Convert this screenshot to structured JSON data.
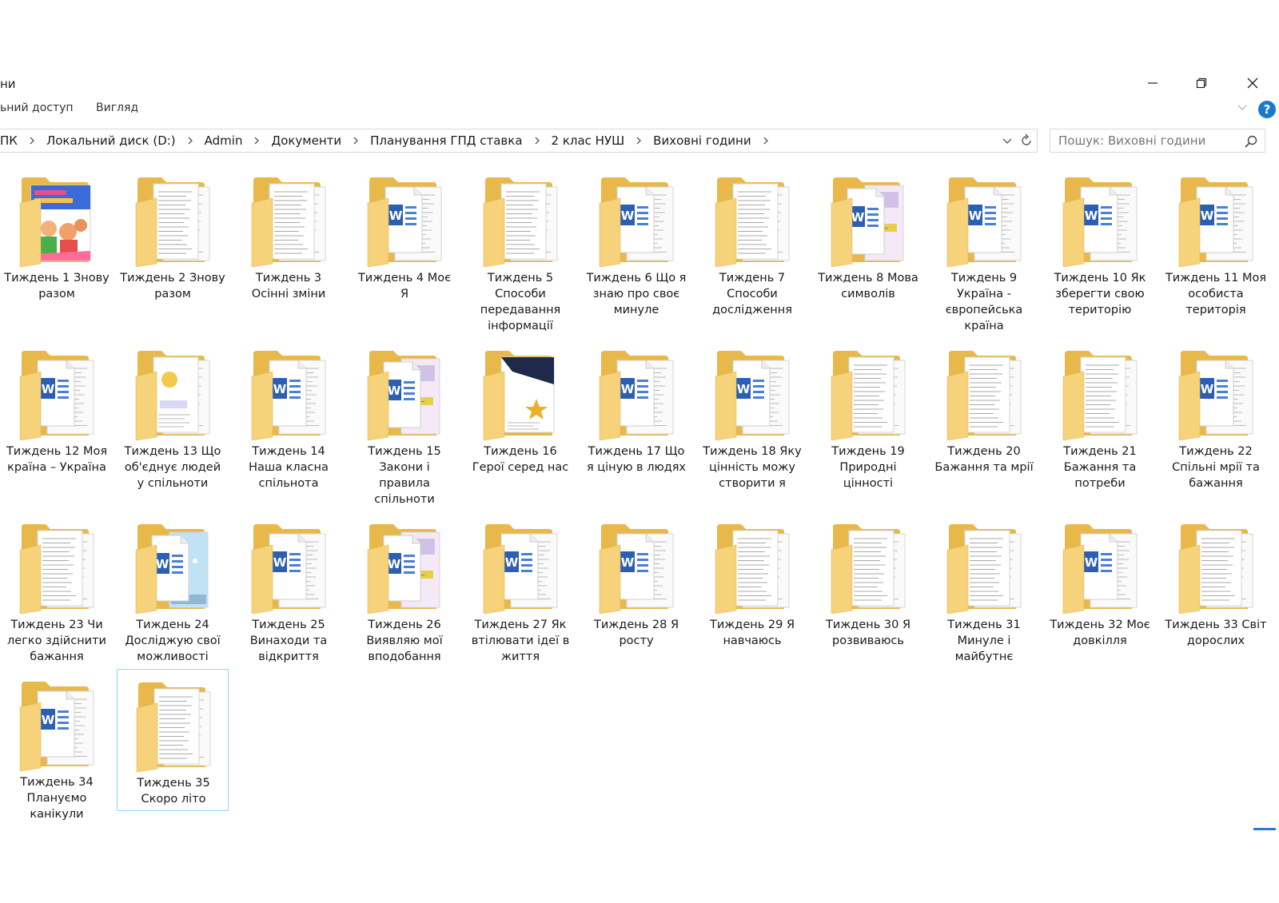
{
  "window": {
    "title_partial": "ни"
  },
  "ribbon": {
    "share_partial": "ьний доступ",
    "view": "Вигляд"
  },
  "address": {
    "crumbs": [
      "ПК",
      "Локальний диск (D:)",
      "Admin",
      "Документи",
      "Планування ГПД ставка",
      "2 клас НУШ",
      "Виховні години"
    ]
  },
  "search": {
    "placeholder": "Пошук: Виховні години"
  },
  "files": [
    {
      "lines": [
        "Тиждень 1 Знову",
        "разом"
      ],
      "thumb": "cover"
    },
    {
      "lines": [
        "Тиждень 2 Знову",
        "разом"
      ],
      "thumb": "text"
    },
    {
      "lines": [
        "Тиждень 3",
        "Осінні зміни"
      ],
      "thumb": "text"
    },
    {
      "lines": [
        "Тиждень 4 Моє",
        "Я"
      ],
      "thumb": "word"
    },
    {
      "lines": [
        "Тиждень 5",
        "Способи",
        "передавання",
        "інформації"
      ],
      "thumb": "text"
    },
    {
      "lines": [
        "Тиждень 6 Що я",
        "знаю про своє",
        "минуле"
      ],
      "thumb": "word"
    },
    {
      "lines": [
        "Тиждень 7",
        "Способи",
        "дослідження"
      ],
      "thumb": "text"
    },
    {
      "lines": [
        "Тиждень 8 Мова",
        "символів"
      ],
      "thumb": "wordpic"
    },
    {
      "lines": [
        "Тиждень 9",
        "Україна -",
        "європейська",
        "країна"
      ],
      "thumb": "word"
    },
    {
      "lines": [
        "Тиждень 10 Як",
        "зберегти свою",
        "територію"
      ],
      "thumb": "word"
    },
    {
      "lines": [
        "Тиждень 11 Моя",
        "особиста",
        "територія"
      ],
      "thumb": "word"
    },
    {
      "lines": [
        "Тиждень 12 Моя",
        "країна – Україна"
      ],
      "thumb": "word"
    },
    {
      "lines": [
        "Тиждень 13 Що",
        "об'єднує людей",
        "у спільноти"
      ],
      "thumb": "pic"
    },
    {
      "lines": [
        "Тиждень 14",
        "Наша класна",
        "спільнота"
      ],
      "thumb": "word"
    },
    {
      "lines": [
        "Тиждень 15",
        "Закони і",
        "правила",
        "спільноти"
      ],
      "thumb": "wordpic"
    },
    {
      "lines": [
        "Тиждень 16",
        "Герої серед нас"
      ],
      "thumb": "dark"
    },
    {
      "lines": [
        "Тиждень 17 Що",
        "я ціную в людях"
      ],
      "thumb": "word"
    },
    {
      "lines": [
        "Тиждень 18 Яку",
        "цінність можу",
        "створити я"
      ],
      "thumb": "word"
    },
    {
      "lines": [
        "Тиждень 19",
        "Природні",
        "цінності"
      ],
      "thumb": "text"
    },
    {
      "lines": [
        "Тиждень 20",
        "Бажання та мрії"
      ],
      "thumb": "text"
    },
    {
      "lines": [
        "Тиждень 21",
        "Бажання та",
        "потреби"
      ],
      "thumb": "text"
    },
    {
      "lines": [
        "Тиждень 22",
        "Спільні мрії та",
        "бажання"
      ],
      "thumb": "word"
    },
    {
      "lines": [
        "Тиждень 23 Чи",
        "легко здійснити",
        "бажання"
      ],
      "thumb": "text"
    },
    {
      "lines": [
        "Тиждень 24",
        "Досліджую свої",
        "можливості"
      ],
      "thumb": "wordsky"
    },
    {
      "lines": [
        "Тиждень 25",
        "Винаходи та",
        "відкриття"
      ],
      "thumb": "word"
    },
    {
      "lines": [
        "Тиждень 26",
        "Виявляю мої",
        "вподобання"
      ],
      "thumb": "wordpic"
    },
    {
      "lines": [
        "Тиждень 27 Як",
        "втілювати ідеї в",
        "життя"
      ],
      "thumb": "word"
    },
    {
      "lines": [
        "Тиждень 28 Я",
        "росту"
      ],
      "thumb": "word"
    },
    {
      "lines": [
        "Тиждень 29 Я",
        "навчаюсь"
      ],
      "thumb": "text"
    },
    {
      "lines": [
        "Тиждень 30 Я",
        "розвиваюсь"
      ],
      "thumb": "text"
    },
    {
      "lines": [
        "Тиждень 31",
        "Минуле і",
        "майбутнє"
      ],
      "thumb": "text"
    },
    {
      "lines": [
        "Тиждень 32 Моє",
        "довкілля"
      ],
      "thumb": "word"
    },
    {
      "lines": [
        "Тиждень 33 Світ",
        "дорослих"
      ],
      "thumb": "text"
    },
    {
      "lines": [
        "Тиждень 34",
        "Плануємо",
        "канікули"
      ],
      "thumb": "word"
    },
    {
      "lines": [
        "Тиждень 35",
        "Скоро літо"
      ],
      "thumb": "text",
      "selected": true
    }
  ]
}
